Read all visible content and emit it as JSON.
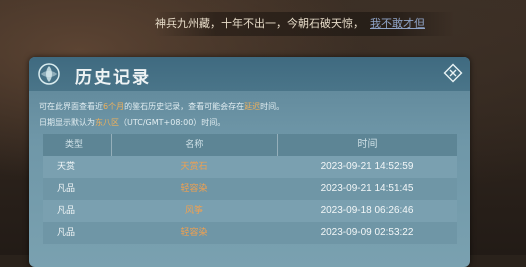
{
  "marquee": {
    "text": "神兵九州藏，十年不出一，今朝石破天惊，",
    "link": "我不敢才但"
  },
  "dialog": {
    "title": "历史记录",
    "desc_line1_pre": "可在此界面查看近",
    "desc_line1_highlight": "6个月",
    "desc_line1_mid": "的鉴石历史记录，查看可能会存在",
    "desc_line1_highlight2": "延迟",
    "desc_line1_post": "时间。",
    "desc_line2_pre": "日期显示默认为",
    "desc_line2_highlight": "东八区",
    "desc_line2_post": "（UTC/GMT+08:00）时间。"
  },
  "table": {
    "headers": [
      "类型",
      "名称",
      "时间"
    ],
    "rows": [
      {
        "type": "天赏",
        "name": "天赏石",
        "time": "2023-09-21 14:52:59"
      },
      {
        "type": "凡品",
        "name": "轻容染",
        "time": "2023-09-21 14:51:45"
      },
      {
        "type": "凡品",
        "name": "风筝",
        "time": "2023-09-18 06:26:46"
      },
      {
        "type": "凡品",
        "name": "轻容染",
        "time": "2023-09-09 02:53:22"
      }
    ]
  }
}
